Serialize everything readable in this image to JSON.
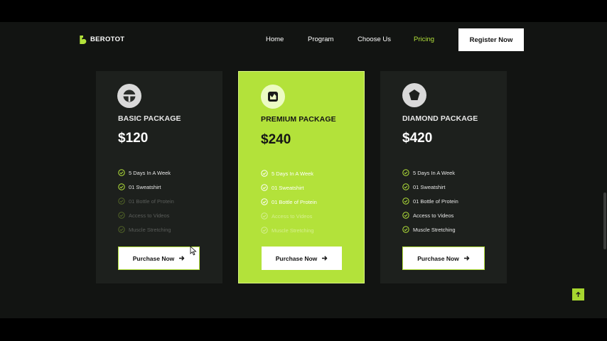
{
  "brand": {
    "name": "BEROTOT",
    "accent": "#b3e23a"
  },
  "nav": {
    "items": [
      {
        "label": "Home"
      },
      {
        "label": "Program"
      },
      {
        "label": "Choose Us"
      },
      {
        "label": "Pricing",
        "active": true
      }
    ],
    "register_label": "Register Now"
  },
  "plans": [
    {
      "title": "BASIC PACKAGE",
      "price": "$120",
      "icon": "steering-wheel-icon",
      "features": [
        {
          "label": "5 Days In A Week",
          "included": true
        },
        {
          "label": "01 Sweatshirt",
          "included": true
        },
        {
          "label": "01 Bottle of Protein",
          "included": false
        },
        {
          "label": "Access to Videos",
          "included": false
        },
        {
          "label": "Muscle Stretching",
          "included": false
        }
      ],
      "button": "Purchase Now"
    },
    {
      "title": "PREMIUM PACKAGE",
      "price": "$240",
      "icon": "crown-icon",
      "highlighted": true,
      "features": [
        {
          "label": "5 Days In A Week",
          "included": true
        },
        {
          "label": "01 Sweatshirt",
          "included": true
        },
        {
          "label": "01 Bottle of Protein",
          "included": true
        },
        {
          "label": "Access to Videos",
          "included": false
        },
        {
          "label": "Muscle Stretching",
          "included": false
        }
      ],
      "button": "Purchase Now"
    },
    {
      "title": "DIAMOND PACKAGE",
      "price": "$420",
      "icon": "diamond-icon",
      "features": [
        {
          "label": "5 Days In A Week",
          "included": true
        },
        {
          "label": "01 Sweatshirt",
          "included": true
        },
        {
          "label": "01 Bottle of Protein",
          "included": true
        },
        {
          "label": "Access to Videos",
          "included": true
        },
        {
          "label": "Muscle Stretching",
          "included": true
        }
      ],
      "button": "Purchase Now"
    }
  ]
}
